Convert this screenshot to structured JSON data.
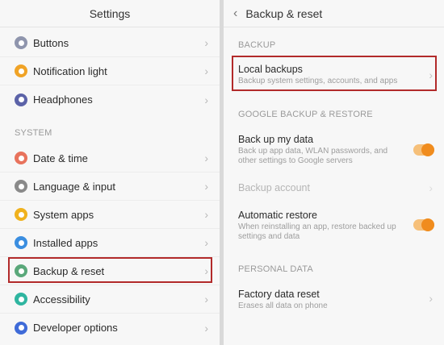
{
  "left": {
    "title": "Settings",
    "items_top": [
      {
        "label": "Buttons",
        "icon": "buttons-icon",
        "color": "#8f95ad"
      },
      {
        "label": "Notification light",
        "icon": "notification-light-icon",
        "color": "#f0a326"
      },
      {
        "label": "Headphones",
        "icon": "headphones-icon",
        "color": "#5c63a8"
      }
    ],
    "section_system": "SYSTEM",
    "items_system": [
      {
        "label": "Date & time",
        "icon": "clock-icon",
        "color": "#e8735d"
      },
      {
        "label": "Language & input",
        "icon": "language-icon",
        "color": "#8a8a8a"
      },
      {
        "label": "System apps",
        "icon": "system-apps-icon",
        "color": "#f0b21e"
      },
      {
        "label": "Installed apps",
        "icon": "installed-apps-icon",
        "color": "#3b8ee0"
      },
      {
        "label": "Backup & reset",
        "icon": "backup-icon",
        "color": "#5aa87a"
      },
      {
        "label": "Accessibility",
        "icon": "accessibility-icon",
        "color": "#2fb5a0"
      },
      {
        "label": "Developer options",
        "icon": "developer-options-icon",
        "color": "#3f6bd8"
      }
    ],
    "chevron": "›"
  },
  "right": {
    "back_glyph": "‹",
    "title": "Backup & reset",
    "section_backup": "BACKUP",
    "local_backups": {
      "title": "Local backups",
      "sub": "Backup system settings, accounts, and apps"
    },
    "section_google": "GOOGLE BACKUP & RESTORE",
    "back_up_data": {
      "title": "Back up my data",
      "sub": "Back up app data, WLAN passwords, and other settings to Google servers",
      "toggle_on": true
    },
    "backup_account": {
      "title": "Backup account"
    },
    "auto_restore": {
      "title": "Automatic restore",
      "sub": "When reinstalling an app, restore backed up settings and data",
      "toggle_on": true
    },
    "section_personal": "PERSONAL DATA",
    "factory_reset": {
      "title": "Factory data reset",
      "sub": "Erases all data on phone"
    },
    "chevron": "›"
  },
  "colors": {
    "highlight": "#b22a2a",
    "toggle_accent": "#f08c1e"
  }
}
